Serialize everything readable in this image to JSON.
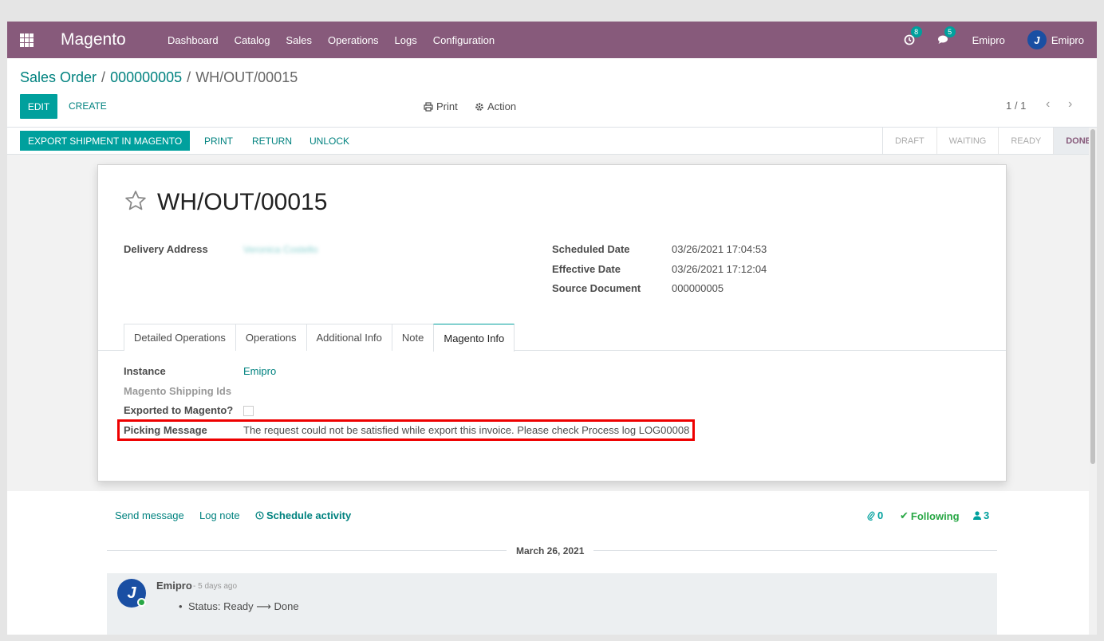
{
  "navbar": {
    "brand": "Magento",
    "menu": [
      "Dashboard",
      "Catalog",
      "Sales",
      "Operations",
      "Logs",
      "Configuration"
    ],
    "activity_count": "8",
    "message_count": "5",
    "company": "Emipro",
    "user": "Emipro"
  },
  "breadcrumb": {
    "root": "Sales Order",
    "parent": "000000005",
    "current": "WH/OUT/00015",
    "sep": "/"
  },
  "buttons": {
    "edit": "EDIT",
    "create": "CREATE",
    "print": "Print",
    "action": "Action"
  },
  "pager": "1 / 1",
  "statusbar": {
    "export": "EXPORT SHIPMENT IN MAGENTO",
    "print": "PRINT",
    "return": "RETURN",
    "unlock": "UNLOCK",
    "stages": [
      "DRAFT",
      "WAITING",
      "READY",
      "DONE"
    ],
    "active_stage": "DONE"
  },
  "record": {
    "title": "WH/OUT/00015",
    "delivery_address_label": "Delivery Address",
    "delivery_address_value": "Veronica Costello",
    "scheduled_date_label": "Scheduled Date",
    "scheduled_date": "03/26/2021 17:04:53",
    "effective_date_label": "Effective Date",
    "effective_date": "03/26/2021 17:12:04",
    "source_document_label": "Source Document",
    "source_document": "000000005"
  },
  "tabs": [
    "Detailed Operations",
    "Operations",
    "Additional Info",
    "Note",
    "Magento Info"
  ],
  "active_tab": "Magento Info",
  "magento_info": {
    "instance_label": "Instance",
    "instance_value": "Emipro",
    "shipping_ids_label": "Magento Shipping Ids",
    "exported_label": "Exported to Magento?",
    "exported": false,
    "picking_message_label": "Picking Message",
    "picking_message": "The request could not be satisfied while export this invoice. Please check Process log LOG00008"
  },
  "colors": {
    "primary": "#875a7b",
    "accent": "#00a09d",
    "highlight": "#e00000"
  },
  "chatter": {
    "send_message": "Send message",
    "log_note": "Log note",
    "schedule_activity": "Schedule activity",
    "attachments": "0",
    "following": "Following",
    "followers": "3",
    "date": "March 26, 2021",
    "message": {
      "author": "Emipro",
      "time": "- 5 days ago",
      "body": "Status: Ready ⟶ Done"
    }
  }
}
